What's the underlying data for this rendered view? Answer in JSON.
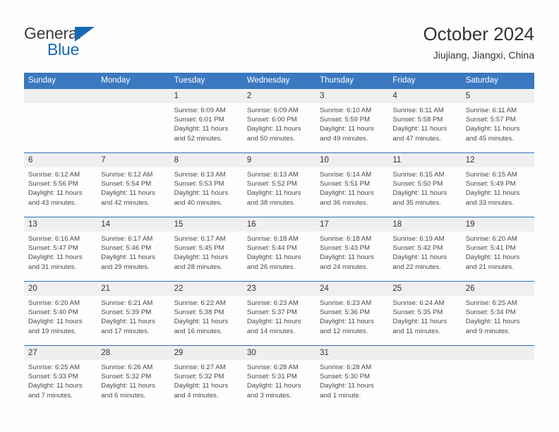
{
  "brand": {
    "name_top": "General",
    "name_bottom": "Blue",
    "triangle_color": "#1669b4",
    "text_color": "#3c3c3c"
  },
  "header": {
    "title": "October 2024",
    "subtitle": "Jiujiang, Jiangxi, China",
    "accent_color": "#3b78c0"
  },
  "calendar": {
    "weekday_headers": [
      "Sunday",
      "Monday",
      "Tuesday",
      "Wednesday",
      "Thursday",
      "Friday",
      "Saturday"
    ],
    "labels": {
      "sunrise": "Sunrise:",
      "sunset": "Sunset:",
      "daylight": "Daylight:"
    },
    "weeks": [
      [
        {
          "day": "",
          "sunrise": "",
          "sunset": "",
          "daylight1": "",
          "daylight2": ""
        },
        {
          "day": "",
          "sunrise": "",
          "sunset": "",
          "daylight1": "",
          "daylight2": ""
        },
        {
          "day": "1",
          "sunrise": "Sunrise: 6:09 AM",
          "sunset": "Sunset: 6:01 PM",
          "daylight1": "Daylight: 11 hours",
          "daylight2": "and 52 minutes."
        },
        {
          "day": "2",
          "sunrise": "Sunrise: 6:09 AM",
          "sunset": "Sunset: 6:00 PM",
          "daylight1": "Daylight: 11 hours",
          "daylight2": "and 50 minutes."
        },
        {
          "day": "3",
          "sunrise": "Sunrise: 6:10 AM",
          "sunset": "Sunset: 5:59 PM",
          "daylight1": "Daylight: 11 hours",
          "daylight2": "and 49 minutes."
        },
        {
          "day": "4",
          "sunrise": "Sunrise: 6:11 AM",
          "sunset": "Sunset: 5:58 PM",
          "daylight1": "Daylight: 11 hours",
          "daylight2": "and 47 minutes."
        },
        {
          "day": "5",
          "sunrise": "Sunrise: 6:11 AM",
          "sunset": "Sunset: 5:57 PM",
          "daylight1": "Daylight: 11 hours",
          "daylight2": "and 45 minutes."
        }
      ],
      [
        {
          "day": "6",
          "sunrise": "Sunrise: 6:12 AM",
          "sunset": "Sunset: 5:56 PM",
          "daylight1": "Daylight: 11 hours",
          "daylight2": "and 43 minutes."
        },
        {
          "day": "7",
          "sunrise": "Sunrise: 6:12 AM",
          "sunset": "Sunset: 5:54 PM",
          "daylight1": "Daylight: 11 hours",
          "daylight2": "and 42 minutes."
        },
        {
          "day": "8",
          "sunrise": "Sunrise: 6:13 AM",
          "sunset": "Sunset: 5:53 PM",
          "daylight1": "Daylight: 11 hours",
          "daylight2": "and 40 minutes."
        },
        {
          "day": "9",
          "sunrise": "Sunrise: 6:13 AM",
          "sunset": "Sunset: 5:52 PM",
          "daylight1": "Daylight: 11 hours",
          "daylight2": "and 38 minutes."
        },
        {
          "day": "10",
          "sunrise": "Sunrise: 6:14 AM",
          "sunset": "Sunset: 5:51 PM",
          "daylight1": "Daylight: 11 hours",
          "daylight2": "and 36 minutes."
        },
        {
          "day": "11",
          "sunrise": "Sunrise: 6:15 AM",
          "sunset": "Sunset: 5:50 PM",
          "daylight1": "Daylight: 11 hours",
          "daylight2": "and 35 minutes."
        },
        {
          "day": "12",
          "sunrise": "Sunrise: 6:15 AM",
          "sunset": "Sunset: 5:49 PM",
          "daylight1": "Daylight: 11 hours",
          "daylight2": "and 33 minutes."
        }
      ],
      [
        {
          "day": "13",
          "sunrise": "Sunrise: 6:16 AM",
          "sunset": "Sunset: 5:47 PM",
          "daylight1": "Daylight: 11 hours",
          "daylight2": "and 31 minutes."
        },
        {
          "day": "14",
          "sunrise": "Sunrise: 6:17 AM",
          "sunset": "Sunset: 5:46 PM",
          "daylight1": "Daylight: 11 hours",
          "daylight2": "and 29 minutes."
        },
        {
          "day": "15",
          "sunrise": "Sunrise: 6:17 AM",
          "sunset": "Sunset: 5:45 PM",
          "daylight1": "Daylight: 11 hours",
          "daylight2": "and 28 minutes."
        },
        {
          "day": "16",
          "sunrise": "Sunrise: 6:18 AM",
          "sunset": "Sunset: 5:44 PM",
          "daylight1": "Daylight: 11 hours",
          "daylight2": "and 26 minutes."
        },
        {
          "day": "17",
          "sunrise": "Sunrise: 6:18 AM",
          "sunset": "Sunset: 5:43 PM",
          "daylight1": "Daylight: 11 hours",
          "daylight2": "and 24 minutes."
        },
        {
          "day": "18",
          "sunrise": "Sunrise: 6:19 AM",
          "sunset": "Sunset: 5:42 PM",
          "daylight1": "Daylight: 11 hours",
          "daylight2": "and 22 minutes."
        },
        {
          "day": "19",
          "sunrise": "Sunrise: 6:20 AM",
          "sunset": "Sunset: 5:41 PM",
          "daylight1": "Daylight: 11 hours",
          "daylight2": "and 21 minutes."
        }
      ],
      [
        {
          "day": "20",
          "sunrise": "Sunrise: 6:20 AM",
          "sunset": "Sunset: 5:40 PM",
          "daylight1": "Daylight: 11 hours",
          "daylight2": "and 19 minutes."
        },
        {
          "day": "21",
          "sunrise": "Sunrise: 6:21 AM",
          "sunset": "Sunset: 5:39 PM",
          "daylight1": "Daylight: 11 hours",
          "daylight2": "and 17 minutes."
        },
        {
          "day": "22",
          "sunrise": "Sunrise: 6:22 AM",
          "sunset": "Sunset: 5:38 PM",
          "daylight1": "Daylight: 11 hours",
          "daylight2": "and 16 minutes."
        },
        {
          "day": "23",
          "sunrise": "Sunrise: 6:23 AM",
          "sunset": "Sunset: 5:37 PM",
          "daylight1": "Daylight: 11 hours",
          "daylight2": "and 14 minutes."
        },
        {
          "day": "24",
          "sunrise": "Sunrise: 6:23 AM",
          "sunset": "Sunset: 5:36 PM",
          "daylight1": "Daylight: 11 hours",
          "daylight2": "and 12 minutes."
        },
        {
          "day": "25",
          "sunrise": "Sunrise: 6:24 AM",
          "sunset": "Sunset: 5:35 PM",
          "daylight1": "Daylight: 11 hours",
          "daylight2": "and 11 minutes."
        },
        {
          "day": "26",
          "sunrise": "Sunrise: 6:25 AM",
          "sunset": "Sunset: 5:34 PM",
          "daylight1": "Daylight: 11 hours",
          "daylight2": "and 9 minutes."
        }
      ],
      [
        {
          "day": "27",
          "sunrise": "Sunrise: 6:25 AM",
          "sunset": "Sunset: 5:33 PM",
          "daylight1": "Daylight: 11 hours",
          "daylight2": "and 7 minutes."
        },
        {
          "day": "28",
          "sunrise": "Sunrise: 6:26 AM",
          "sunset": "Sunset: 5:32 PM",
          "daylight1": "Daylight: 11 hours",
          "daylight2": "and 6 minutes."
        },
        {
          "day": "29",
          "sunrise": "Sunrise: 6:27 AM",
          "sunset": "Sunset: 5:32 PM",
          "daylight1": "Daylight: 11 hours",
          "daylight2": "and 4 minutes."
        },
        {
          "day": "30",
          "sunrise": "Sunrise: 6:28 AM",
          "sunset": "Sunset: 5:31 PM",
          "daylight1": "Daylight: 11 hours",
          "daylight2": "and 3 minutes."
        },
        {
          "day": "31",
          "sunrise": "Sunrise: 6:28 AM",
          "sunset": "Sunset: 5:30 PM",
          "daylight1": "Daylight: 11 hours",
          "daylight2": "and 1 minute."
        },
        {
          "day": "",
          "sunrise": "",
          "sunset": "",
          "daylight1": "",
          "daylight2": ""
        },
        {
          "day": "",
          "sunrise": "",
          "sunset": "",
          "daylight1": "",
          "daylight2": ""
        }
      ]
    ]
  }
}
